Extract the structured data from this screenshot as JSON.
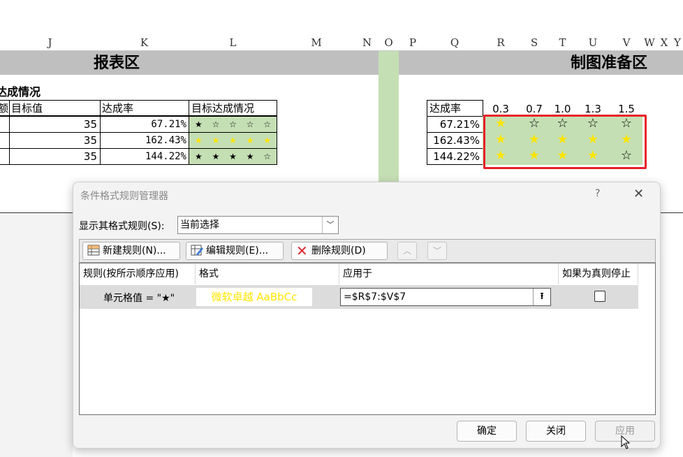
{
  "sheet": {
    "columns": [
      "J",
      "K",
      "L",
      "M",
      "N",
      "O",
      "P",
      "Q",
      "R",
      "S",
      "T",
      "U",
      "V",
      "W",
      "X",
      "Y"
    ],
    "band_left": "报表区",
    "band_right": "制图准备区",
    "section_title": "达成情况",
    "left_table": {
      "headers": [
        "额",
        "目标值",
        "达成率",
        "目标达成情况"
      ],
      "rows": [
        {
          "target": "35",
          "rate": "67.21%",
          "stars": "★ ☆ ☆ ☆ ☆"
        },
        {
          "target": "35",
          "rate": "162.43%",
          "stars": "★ ★ ★ ★ ★"
        },
        {
          "target": "35",
          "rate": "144.22%",
          "stars": "★ ★ ★ ★ ☆"
        }
      ]
    },
    "right_table": {
      "header": "达成率",
      "thresholds": [
        "0.3",
        "0.7",
        "1.0",
        "1.3",
        "1.5"
      ],
      "rates": [
        "67.21%",
        "162.43%",
        "144.22%"
      ],
      "stars": [
        [
          "★",
          "☆",
          "☆",
          "☆",
          "☆"
        ],
        [
          "★",
          "★",
          "★",
          "★",
          "★"
        ],
        [
          "★",
          "★",
          "★",
          "★",
          "☆"
        ]
      ]
    }
  },
  "dialog": {
    "title": "条件格式规则管理器",
    "help": "?",
    "close": "✕",
    "show_rules_label": "显示其格式规则(S):",
    "show_rules_value": "当前选择",
    "toolbar": {
      "new_rule": "新建规则(N)...",
      "edit_rule": "编辑规则(E)...",
      "delete_rule": "删除规则(D)"
    },
    "columns": [
      "规则(按所示顺序应用)",
      "格式",
      "应用于",
      "如果为真则停止"
    ],
    "rule": {
      "name": "单元格值 = \"★\"",
      "format_preview": "微软卓越  AaBbCc",
      "applies_to": "=$R$7:$V$7"
    },
    "buttons": {
      "ok": "确定",
      "close": "关闭",
      "apply": "应用"
    }
  },
  "colors": {
    "green": "#c5dfb4",
    "star": "#ffe600",
    "highlight": "#e8202a"
  }
}
